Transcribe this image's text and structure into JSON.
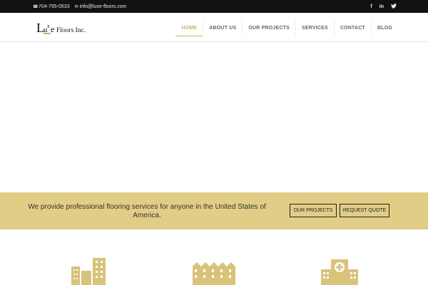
{
  "topbar": {
    "phone": "704-795-0533",
    "email": "info@luxe-floors.com",
    "social": [
      "f",
      "in",
      "t"
    ]
  },
  "header": {
    "logo_text": "Luxe Floors Inc.",
    "nav": [
      "HOME",
      "ABOUT US",
      "OUR PROJECTS",
      "SERVICES",
      "CONTACT",
      "BLOG"
    ],
    "active_nav": "HOME"
  },
  "band": {
    "text": "We provide professional flooring services for anyone in the United States of America.",
    "buttons": [
      "OUR PROJECTS",
      "REQUEST QUOTE"
    ]
  },
  "colors": {
    "accent": "#c9b26b",
    "band": "#e2cd87",
    "topbar": "#111111"
  }
}
